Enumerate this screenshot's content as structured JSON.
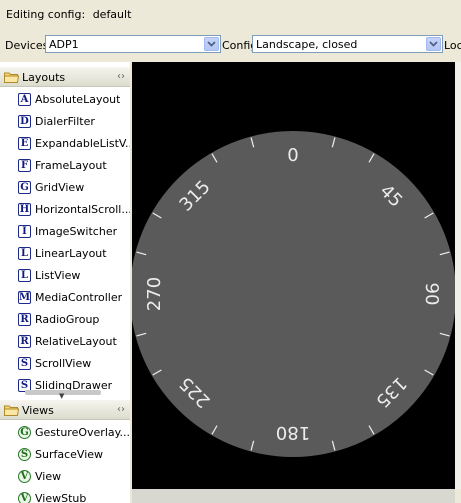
{
  "header": {
    "editing_label": "Editing config:",
    "config_name": "default"
  },
  "toolbar": {
    "devices_label": "Devices",
    "device_value": "ADP1",
    "config_label": "Config",
    "config_value": "Landscape, closed",
    "locale_label": "Loca"
  },
  "palette": {
    "layouts": {
      "label": "Layouts",
      "items": [
        {
          "glyph": "A",
          "label": "AbsoluteLayout"
        },
        {
          "glyph": "D",
          "label": "DialerFilter"
        },
        {
          "glyph": "E",
          "label": "ExpandableListV..."
        },
        {
          "glyph": "F",
          "label": "FrameLayout"
        },
        {
          "glyph": "G",
          "label": "GridView"
        },
        {
          "glyph": "H",
          "label": "HorizontalScroll..."
        },
        {
          "glyph": "I",
          "label": "ImageSwitcher"
        },
        {
          "glyph": "L",
          "label": "LinearLayout"
        },
        {
          "glyph": "L",
          "label": "ListView"
        },
        {
          "glyph": "M",
          "label": "MediaController"
        },
        {
          "glyph": "R",
          "label": "RadioGroup"
        },
        {
          "glyph": "R",
          "label": "RelativeLayout"
        },
        {
          "glyph": "S",
          "label": "ScrollView"
        },
        {
          "glyph": "S",
          "label": "SlidingDrawer"
        }
      ]
    },
    "views": {
      "label": "Views",
      "items": [
        {
          "glyph": "G",
          "label": "GestureOverlay..."
        },
        {
          "glyph": "S",
          "label": "SurfaceView"
        },
        {
          "glyph": "V",
          "label": "View"
        },
        {
          "glyph": "V",
          "label": "ViewStub"
        }
      ]
    }
  },
  "dial": {
    "labels": [
      "0",
      "45",
      "90",
      "135",
      "180",
      "225",
      "270",
      "315"
    ],
    "dial_color": "#5a5a5a",
    "tick_color": "#f0f0f0",
    "screen_color": "#000000"
  },
  "icons": {
    "folder": "folder-icon",
    "collapse": "collapse-arrows-icon",
    "dropdown": "chevron-down-icon"
  }
}
